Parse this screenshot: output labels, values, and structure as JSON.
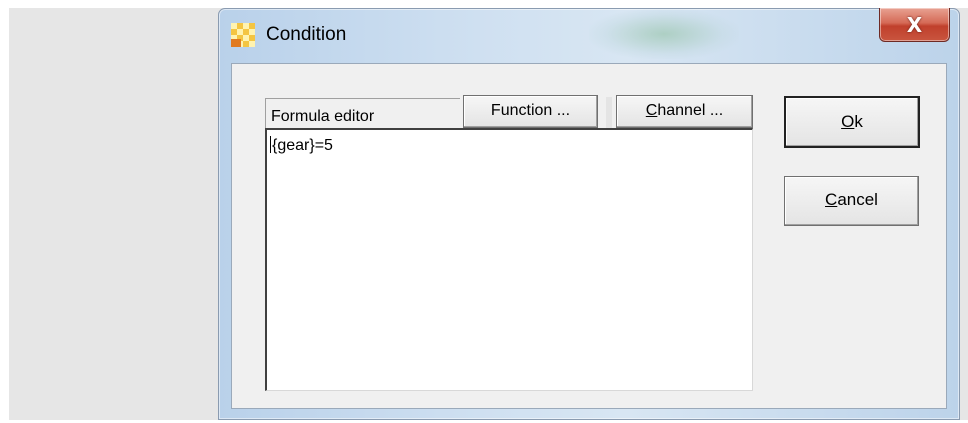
{
  "window": {
    "title": "Condition",
    "close_symbol": "X"
  },
  "editor": {
    "header_label": "Formula editor",
    "function_button": "Function ...",
    "channel_button_prefix": "",
    "channel_button_mnemonic": "C",
    "channel_button_suffix": "hannel ...",
    "formula_text": "{gear}=5"
  },
  "actions": {
    "ok_mnemonic": "O",
    "ok_suffix": "k",
    "cancel_mnemonic": "C",
    "cancel_suffix": "ancel"
  },
  "icons": {
    "app": "condition-app-icon",
    "close": "close-icon"
  },
  "colors": {
    "close_button": "#c9553f",
    "titlebar": "#cfe0f1",
    "client": "#f0f0f0"
  }
}
